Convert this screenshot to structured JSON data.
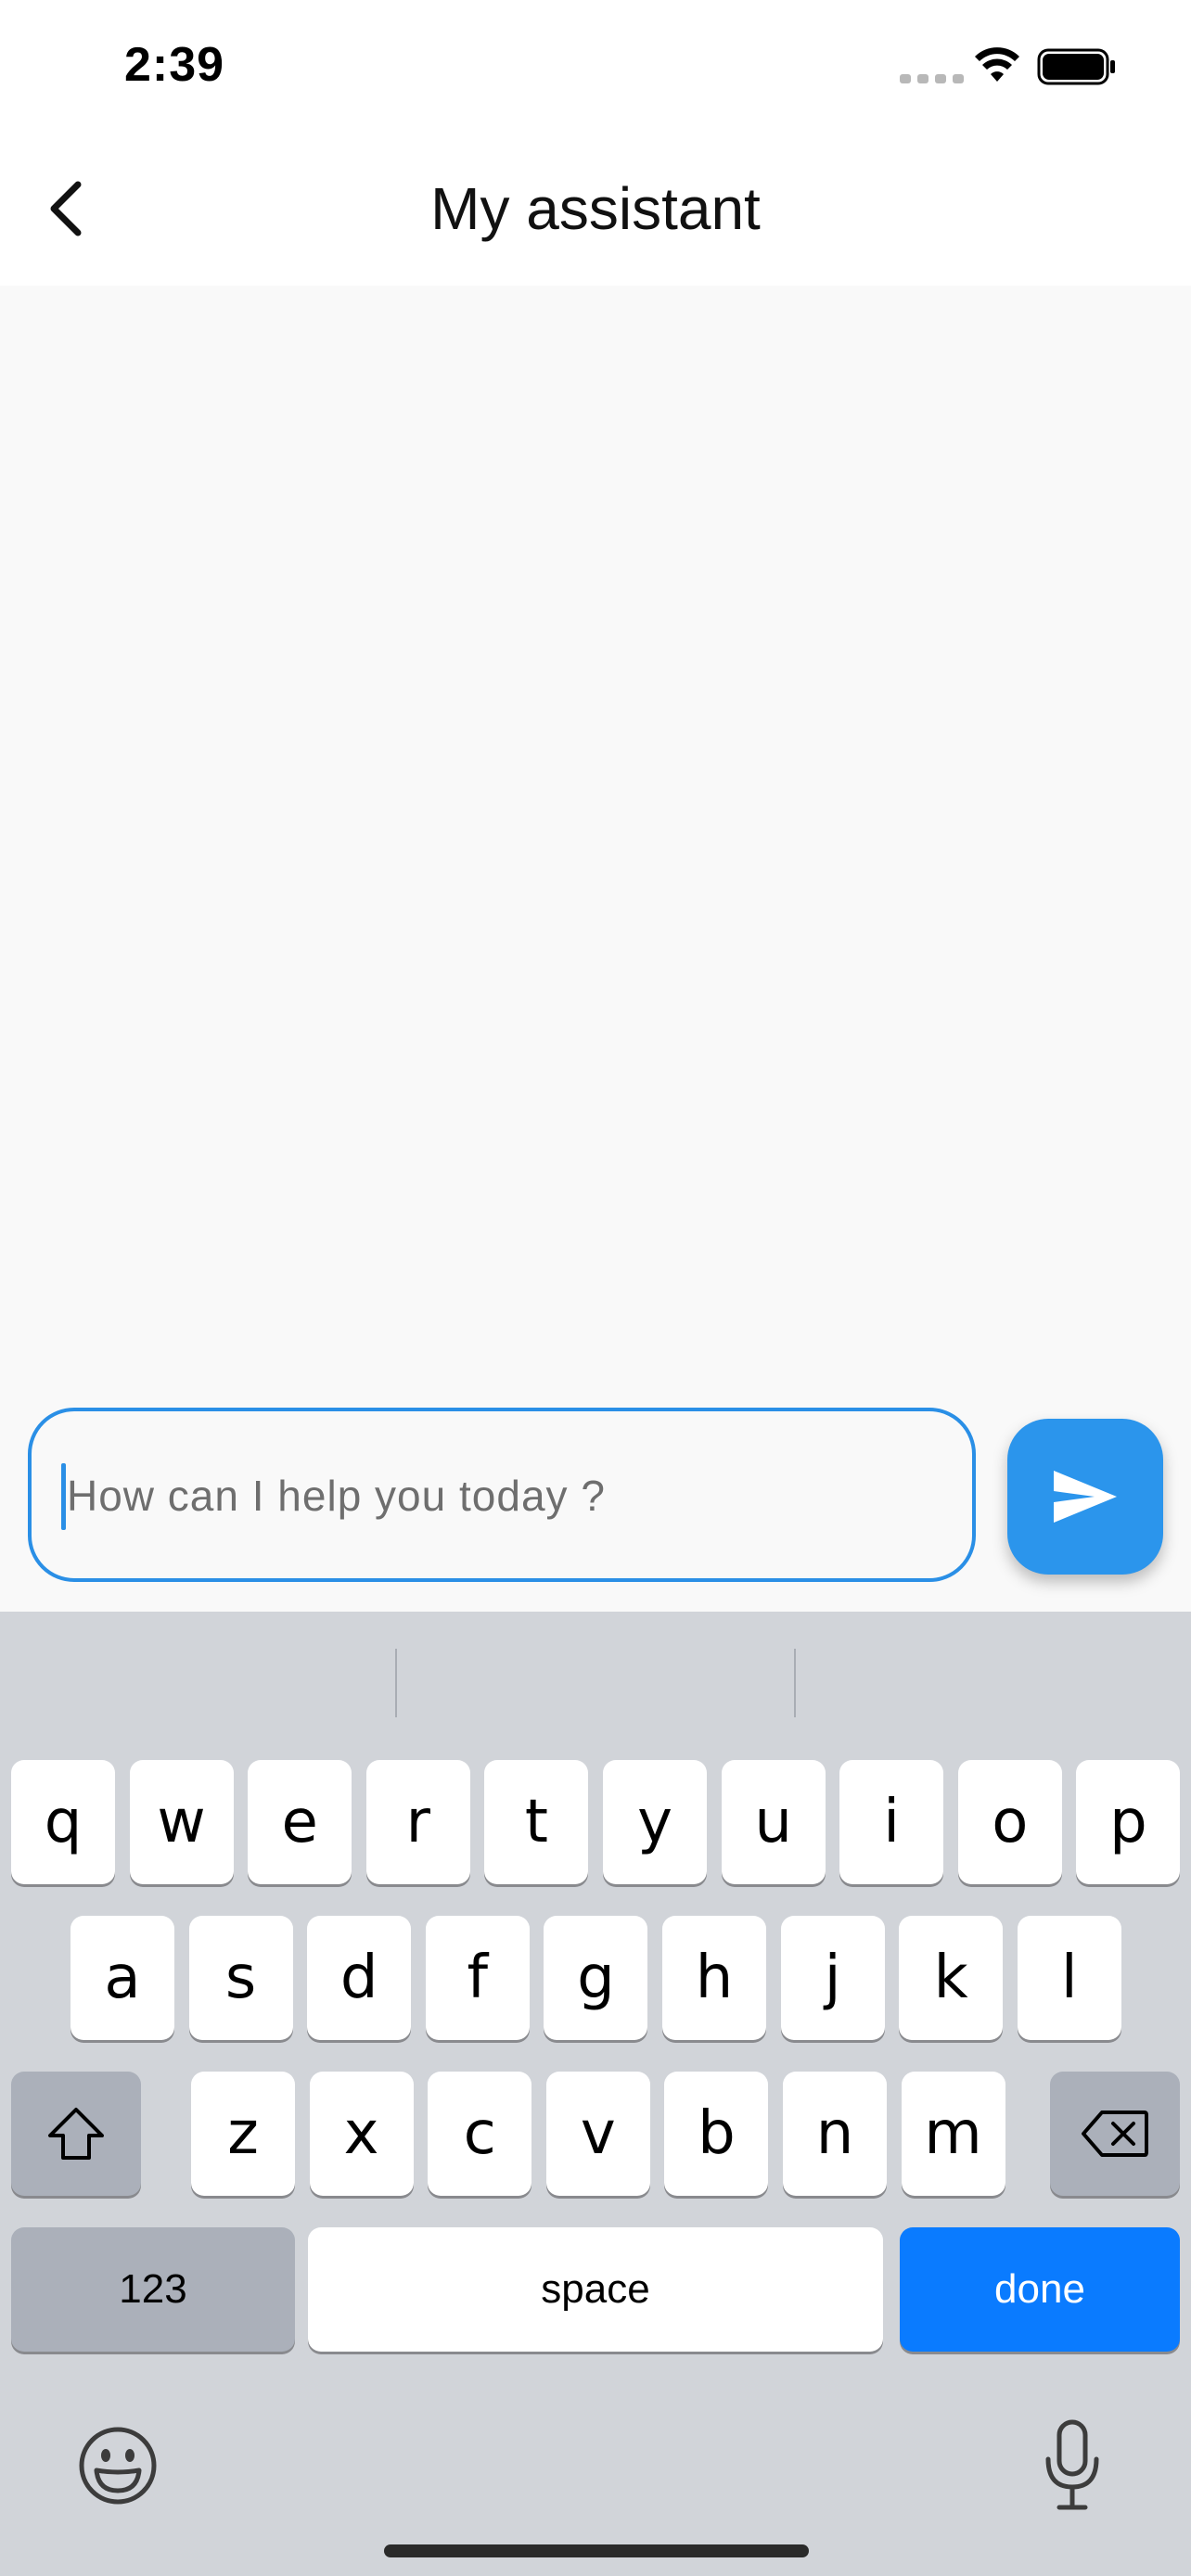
{
  "status_bar": {
    "time": "2:39"
  },
  "nav": {
    "title": "My assistant"
  },
  "composer": {
    "placeholder": "How can I help you today ?",
    "value": ""
  },
  "colors": {
    "accent": "#2b95ec",
    "done_key": "#0a7bff",
    "keyboard_bg": "#d1d4d9"
  },
  "keyboard": {
    "row1": [
      "q",
      "w",
      "e",
      "r",
      "t",
      "y",
      "u",
      "i",
      "o",
      "p"
    ],
    "row2": [
      "a",
      "s",
      "d",
      "f",
      "g",
      "h",
      "j",
      "k",
      "l"
    ],
    "row3": [
      "z",
      "x",
      "c",
      "v",
      "b",
      "n",
      "m"
    ],
    "numbers_label": "123",
    "space_label": "space",
    "done_label": "done",
    "shift_icon": "shift-icon",
    "delete_icon": "delete-backspace-icon",
    "emoji_icon": "emoji-icon",
    "mic_icon": "microphone-icon"
  }
}
